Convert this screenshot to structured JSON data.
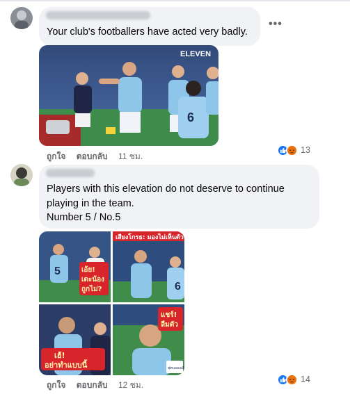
{
  "comments": [
    {
      "text": "Your club's footballers have acted very badly.",
      "more_icon": "more-horizontal-icon",
      "media": {
        "watermark": "ELEVEN"
      },
      "actions": {
        "like": "ถูกใจ",
        "reply": "ตอบกลับ",
        "time": "11 ชม."
      },
      "reactions": {
        "icons": [
          "like-icon",
          "angry-icon"
        ],
        "count": "13"
      }
    },
    {
      "text_lines": [
        "Players with this elevation do not deserve to continue",
        "playing in the team.",
        "Number 5 / No.5"
      ],
      "media": {
        "overlays": [
          "เสียงโกรธ: มองไม่เห็นตัว",
          "เอ้ย! เตะน้อง ถูกไม่?",
          "เฮ้! อย่าทำแบบนี้",
          "แชร์! ลืมตัว"
        ],
        "credit": "ฟุตบอลเอลิก"
      },
      "actions": {
        "like": "ถูกใจ",
        "reply": "ตอบกลับ",
        "time": "12 ชม."
      },
      "reactions": {
        "icons": [
          "like-icon",
          "angry-icon"
        ],
        "count": "14"
      }
    }
  ],
  "colors": {
    "bubble": "#f0f2f5",
    "meta_text": "#65676b",
    "like_blue": "#1877f2",
    "angry_orange": "#e9710f",
    "team_sky": "#8ec6ea"
  }
}
